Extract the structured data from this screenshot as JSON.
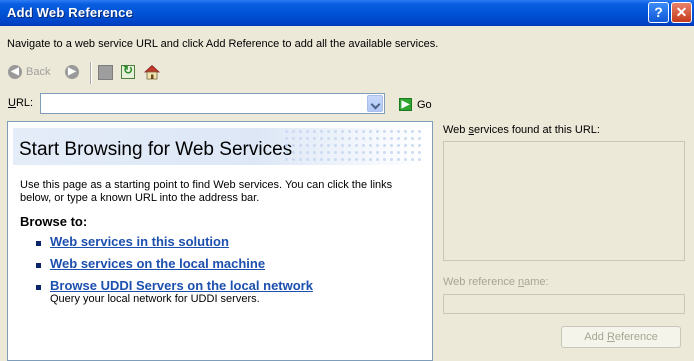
{
  "window": {
    "title": "Add Web Reference",
    "help_glyph": "?",
    "close_glyph": "✕"
  },
  "instructions": "Navigate to a web service URL and click Add Reference to add all the available services.",
  "toolbar": {
    "back_label": "Back",
    "back_enabled": false,
    "forward_enabled": false,
    "stop_enabled": false,
    "icons": [
      "back-arrow-icon",
      "forward-arrow-icon",
      "stop-icon",
      "refresh-icon",
      "home-icon"
    ]
  },
  "url": {
    "label_u": "U",
    "label_rest": "RL:",
    "value": "",
    "placeholder": ""
  },
  "go": {
    "label": "Go"
  },
  "browser": {
    "title": "Start Browsing for Web Services",
    "description": "Use this page as a starting point to find Web services. You can click the links below, or type a known URL into the address bar.",
    "browse_to": "Browse to:",
    "links": [
      {
        "text": "Web services in this solution",
        "sub": ""
      },
      {
        "text": "Web services on the local machine",
        "sub": ""
      },
      {
        "text": "Browse UDDI Servers on the local network",
        "sub": "Query your local network for UDDI servers."
      }
    ]
  },
  "right_panel": {
    "found_label_pre": "Web ",
    "found_label_u": "s",
    "found_label_post": "ervices found at this URL:",
    "name_label_pre": "Web reference ",
    "name_label_u": "n",
    "name_label_post": "ame:",
    "add_button_pre": "Add ",
    "add_button_u": "R",
    "add_button_post": "eference",
    "add_enabled": false
  },
  "colors": {
    "titlebar": "#0053D6",
    "window_bg": "#ECE9D8",
    "link": "#1C4FAE",
    "disabled_text": "#A7A694"
  }
}
